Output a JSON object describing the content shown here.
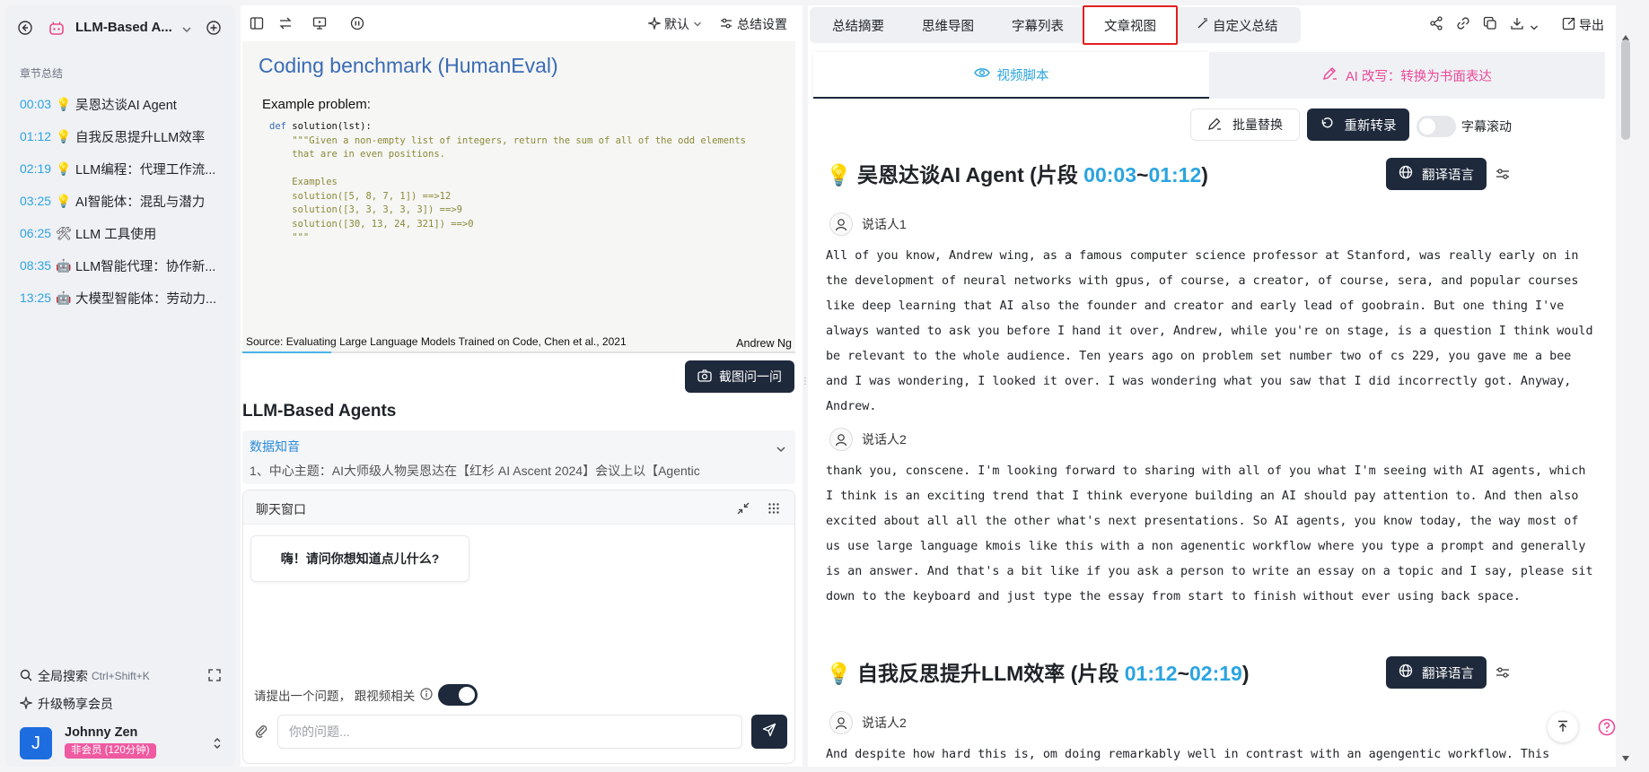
{
  "sidebar": {
    "title": "LLM-Based A...",
    "section_label": "章节总结",
    "chapters": [
      {
        "time": "00:03",
        "icon": "💡",
        "label": "吴恩达谈AI Agent"
      },
      {
        "time": "01:12",
        "icon": "💡",
        "label": "自我反思提升LLM效率"
      },
      {
        "time": "02:19",
        "icon": "💡",
        "label": "LLM编程：代理工作流..."
      },
      {
        "time": "03:25",
        "icon": "💡",
        "label": "AI智能体：混乱与潜力"
      },
      {
        "time": "06:25",
        "icon": "🛠",
        "label": "LLM 工具使用"
      },
      {
        "time": "08:35",
        "icon": "🤖",
        "label": "LLM智能代理：协作新..."
      },
      {
        "time": "13:25",
        "icon": "🤖",
        "label": "大模型智能体：劳动力..."
      }
    ],
    "search_label": "全局搜索",
    "search_shortcut": "Ctrl+Shift+K",
    "upgrade_label": "升级畅享会员",
    "user": {
      "initial": "J",
      "name": "Johnny Zen",
      "badge": "非会员 (120分钟)"
    }
  },
  "middle": {
    "toolbar": {
      "default_label": "默认",
      "settings_label": "总结设置"
    },
    "slide": {
      "title": "Coding benchmark (HumanEval)",
      "example_label": "Example problem:",
      "code_def": "def",
      "code_sig": " solution(lst):",
      "code_doc": "    \"\"\"Given a non-empty list of integers, return the sum of all of the odd elements\n    that are in even positions.\n\n    Examples\n    solution([5, 8, 7, 1]) ==>12\n    solution([3, 3, 3, 3, 3]) ==>9\n    solution([30, 13, 24, 321]) ==>0\n    \"\"\"",
      "source": "Source: Evaluating Large Language Models Trained on Code, Chen et al., 2021",
      "speaker": "Andrew Ng",
      "progress": 0.16
    },
    "screenshot_button": "截图问一问",
    "heading": "LLM-Based Agents",
    "knowledge": {
      "title": "数据知音",
      "body": "1、中心主题：AI大师级人物吴恩达在【红杉 AI Ascent 2024】会议上以【Agentic"
    },
    "chat": {
      "title": "聊天窗口",
      "greeting": "嗨！请问你想知道点儿什么?",
      "hint": "请提出一个问题，  跟视频相关",
      "input_placeholder": "你的问题..."
    }
  },
  "right": {
    "tabs": [
      "总结摘要",
      "思维导图",
      "字幕列表",
      "文章视图",
      "自定义总结"
    ],
    "active_tab": "文章视图",
    "export_label": "导出",
    "subtabs": {
      "script": "视频脚本",
      "rewrite": "AI 改写：转换为书面表达"
    },
    "batch_replace": "批量替换",
    "retranscribe": "重新转录",
    "subtitle_scroll": "字幕滚动",
    "translate": "翻译语言",
    "segments": [
      {
        "title": "吴恩达谈AI Agent (片段 ",
        "start": "00:03",
        "sep": "~",
        "end": "01:12",
        "close": ")",
        "blocks": [
          {
            "speaker": "说话人1",
            "text": "All of you know, Andrew wing, as a famous computer science professor at Stanford, was really early on in the development of neural networks with gpus, of course, a creator, of course, sera, and popular courses like deep learning that AI also the founder and creator and early lead of goobrain. But one thing I've always wanted to ask you before I hand it over, Andrew, while you're on stage, is a question I think would be relevant to the whole audience. Ten years ago on problem set number two of cs 229, you gave me a bee and I was wondering, I looked it over. I was wondering what you saw that I did incorrectly got. Anyway, Andrew."
          },
          {
            "speaker": "说话人2",
            "text": "thank you, conscene. I'm looking forward to sharing with all of you what I'm seeing with AI agents, which I think is an exciting trend that I think everyone building an AI should pay attention to. And then also excited about all all the other what's next presentations. So AI agents, you know today, the way most of us use large language kmois like this with a non agenentic workflow where you type a prompt and generally is an answer. And that's a bit like if you ask a person to write an essay on a topic and I say, please sit down to the keyboard and just type the essay from start to finish without ever using back space."
          }
        ]
      },
      {
        "title": "自我反思提升LLM效率 (片段 ",
        "start": "01:12",
        "sep": "~",
        "end": "02:19",
        "close": ")",
        "blocks": [
          {
            "speaker": "说话人2",
            "text": "And despite how hard this is, om doing remarkably well in contrast with an agengentic workflow. This"
          }
        ]
      }
    ]
  },
  "colors": {
    "accent": "#2ba4e0",
    "dark": "#1e293b",
    "pink": "#ec4899",
    "active_border": "#e02020"
  }
}
